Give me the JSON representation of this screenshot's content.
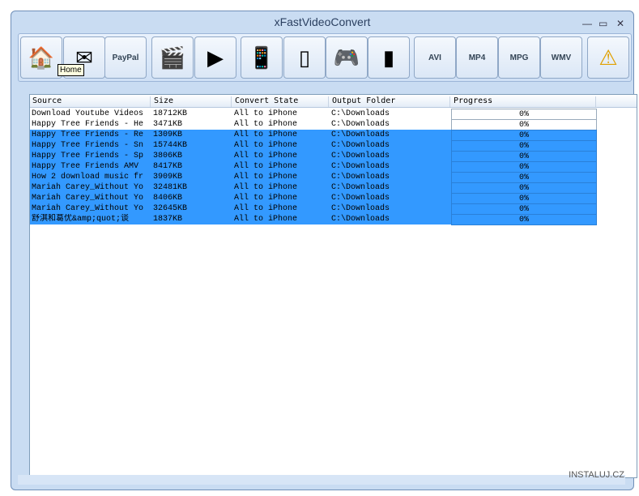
{
  "title": "xFastVideoConvert",
  "tooltip": "Home",
  "toolbar": [
    {
      "name": "home",
      "glyph": "🏠"
    },
    {
      "name": "email",
      "glyph": "✉"
    },
    {
      "name": "paypal",
      "glyph": "PayPal"
    },
    {
      "name": "add-video",
      "glyph": "🎬"
    },
    {
      "name": "convert",
      "glyph": "▶"
    },
    {
      "name": "iphone",
      "glyph": "📱"
    },
    {
      "name": "ipod",
      "glyph": "▯"
    },
    {
      "name": "psp",
      "glyph": "🎮"
    },
    {
      "name": "zune",
      "glyph": "▮"
    },
    {
      "name": "avi",
      "glyph": "AVI"
    },
    {
      "name": "mp4",
      "glyph": "MP4"
    },
    {
      "name": "mpg",
      "glyph": "MPG"
    },
    {
      "name": "wmv",
      "glyph": "WMV"
    },
    {
      "name": "warning",
      "glyph": "⚠"
    }
  ],
  "columns": [
    "Source",
    "Size",
    "Convert State",
    "Output Folder",
    "Progress"
  ],
  "rows": [
    {
      "source": "Download Youtube Videos",
      "size": "18712KB",
      "state": "All to iPhone",
      "folder": "C:\\Downloads",
      "progress": "0%",
      "selected": false
    },
    {
      "source": "Happy Tree Friends - He",
      "size": "3471KB",
      "state": "All to iPhone",
      "folder": "C:\\Downloads",
      "progress": "0%",
      "selected": false
    },
    {
      "source": "Happy Tree Friends - Re",
      "size": "1309KB",
      "state": "All to iPhone",
      "folder": "C:\\Downloads",
      "progress": "0%",
      "selected": true
    },
    {
      "source": "Happy Tree Friends - Sn",
      "size": "15744KB",
      "state": "All to iPhone",
      "folder": "C:\\Downloads",
      "progress": "0%",
      "selected": true
    },
    {
      "source": "Happy Tree Friends - Sp",
      "size": "3806KB",
      "state": "All to iPhone",
      "folder": "C:\\Downloads",
      "progress": "0%",
      "selected": true
    },
    {
      "source": "Happy Tree Friends AMV",
      "size": "8417KB",
      "state": "All to iPhone",
      "folder": "C:\\Downloads",
      "progress": "0%",
      "selected": true
    },
    {
      "source": "How 2 download music fr",
      "size": "3909KB",
      "state": "All to iPhone",
      "folder": "C:\\Downloads",
      "progress": "0%",
      "selected": true
    },
    {
      "source": "Mariah Carey_Without Yo",
      "size": "32481KB",
      "state": "All to iPhone",
      "folder": "C:\\Downloads",
      "progress": "0%",
      "selected": true
    },
    {
      "source": "Mariah Carey_Without Yo",
      "size": "8406KB",
      "state": "All to iPhone",
      "folder": "C:\\Downloads",
      "progress": "0%",
      "selected": true
    },
    {
      "source": "Mariah Carey_Without Yo",
      "size": "32645KB",
      "state": "All to iPhone",
      "folder": "C:\\Downloads",
      "progress": "0%",
      "selected": true
    },
    {
      "source": "舒淇和葛优&amp;quot;谈",
      "size": "1837KB",
      "state": "All to iPhone",
      "folder": "C:\\Downloads",
      "progress": "0%",
      "selected": true
    }
  ],
  "watermark": "INSTALUJ.CZ"
}
